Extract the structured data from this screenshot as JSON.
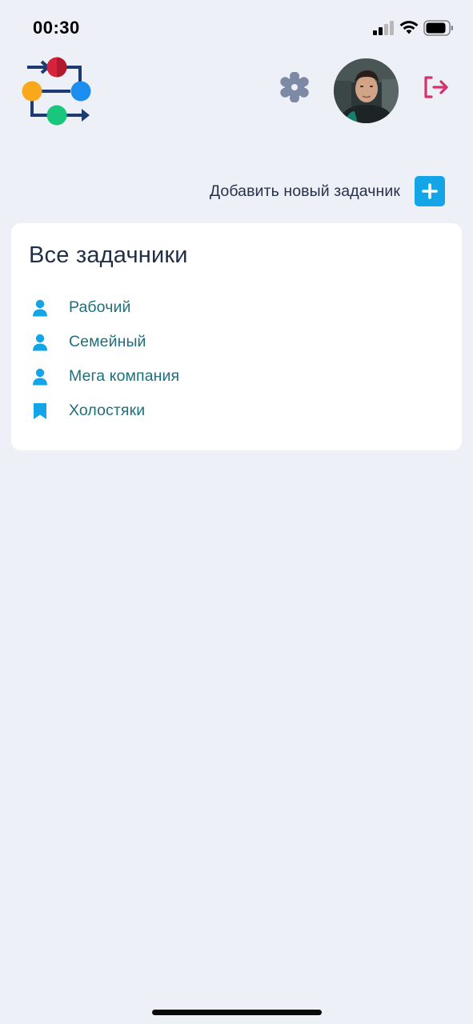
{
  "status_bar": {
    "time": "00:30",
    "signal_icon": "cellular-signal-icon",
    "wifi_icon": "wifi-icon",
    "battery_icon": "battery-icon"
  },
  "header": {
    "logo_icon": "workflow-logo-icon",
    "settings_icon": "gear-icon",
    "avatar": "user-avatar",
    "logout_icon": "logout-icon",
    "colors": {
      "settings": "#7d8aa6",
      "logout": "#d6336c"
    }
  },
  "actions": {
    "add_label": "Добавить новый задачник",
    "add_icon": "plus-icon",
    "accent": "#14a5e8"
  },
  "tasks_card": {
    "title": "Все задачники",
    "items": [
      {
        "label": "Рабочий",
        "icon": "person-icon"
      },
      {
        "label": "Семейный",
        "icon": "person-icon"
      },
      {
        "label": "Мега компания",
        "icon": "person-icon"
      },
      {
        "label": "Холостяки",
        "icon": "bookmark-icon"
      }
    ]
  }
}
